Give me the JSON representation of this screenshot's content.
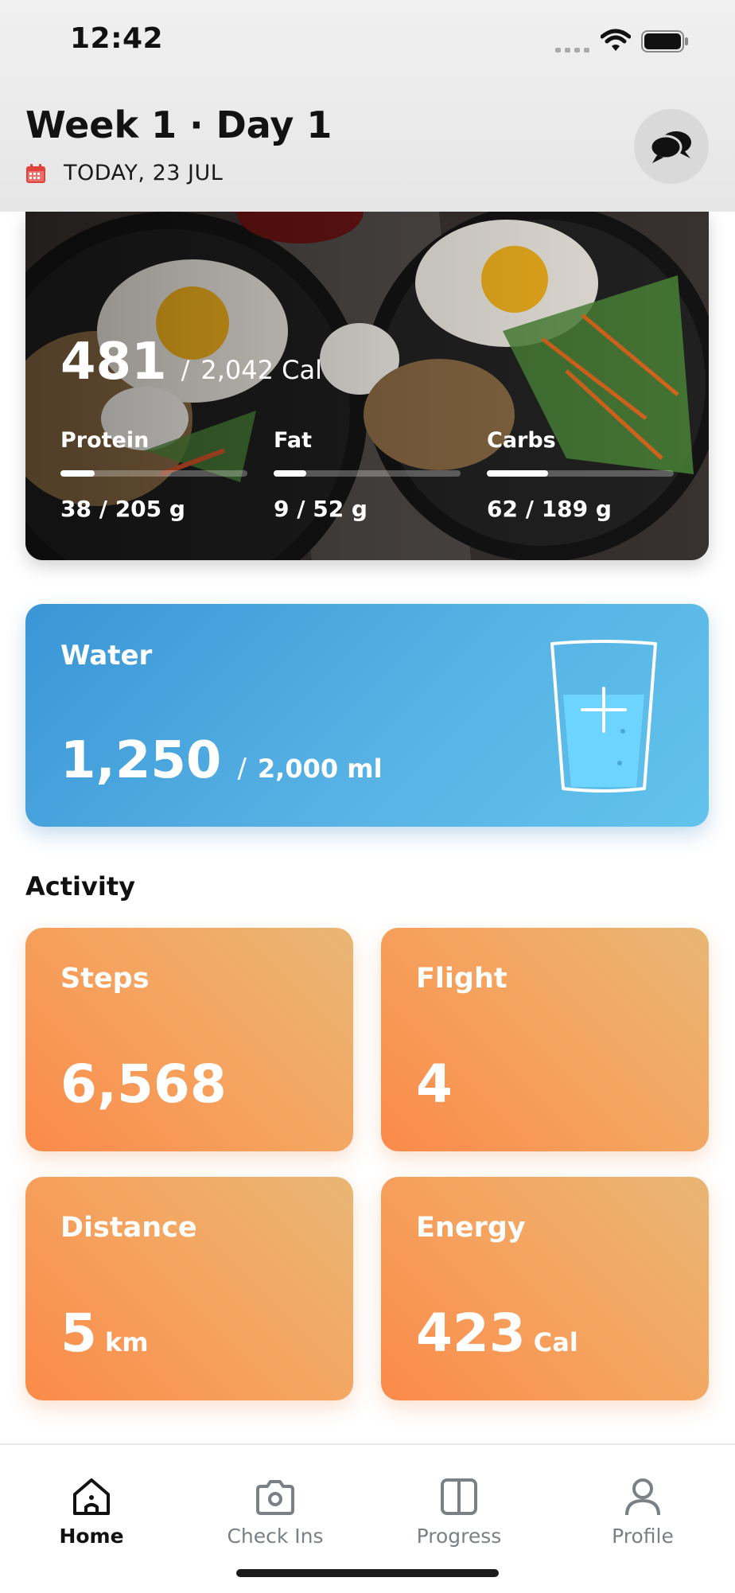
{
  "status_bar": {
    "time": "12:42"
  },
  "header": {
    "title": "Week 1 · Day 1",
    "date": "TODAY, 23 JUL",
    "icons": [
      "calendar-icon",
      "chat-bubbles-icon"
    ]
  },
  "meal_card": {
    "calories_eaten": "481",
    "calories_sep": "/",
    "calories_total": "2,042 Cal",
    "macros": [
      {
        "label": "Protein",
        "value": "38 / 205 g",
        "progress": 0.185
      },
      {
        "label": "Fat",
        "value": "9 / 52 g",
        "progress": 0.173
      },
      {
        "label": "Carbs",
        "value": "62 / 189 g",
        "progress": 0.328
      }
    ]
  },
  "water_card": {
    "label": "Water",
    "value": "1,250",
    "sep": "/",
    "total": "2,000 ml",
    "icon": "water-glass-plus-icon"
  },
  "activity": {
    "title": "Activity",
    "cards": [
      {
        "label": "Steps",
        "value": "6,568",
        "unit": ""
      },
      {
        "label": "Flight",
        "value": "4",
        "unit": ""
      },
      {
        "label": "Distance",
        "value": "5",
        "unit": "km"
      },
      {
        "label": "Energy",
        "value": "423",
        "unit": "Cal"
      }
    ]
  },
  "tabbar": {
    "tabs": [
      {
        "label": "Home",
        "icon": "home-icon",
        "active": true
      },
      {
        "label": "Check Ins",
        "icon": "camera-icon",
        "active": false
      },
      {
        "label": "Progress",
        "icon": "split-view-icon",
        "active": false
      },
      {
        "label": "Profile",
        "icon": "person-icon",
        "active": false
      }
    ]
  },
  "colors": {
    "water_gradient": [
      "#3a95d6",
      "#62c3ec"
    ],
    "activity_gradient": [
      "#fb8a4a",
      "#e8b674"
    ],
    "calendar_icon": "#e2403b",
    "tab_active": "#111111",
    "tab_inactive": "#7b8087"
  }
}
